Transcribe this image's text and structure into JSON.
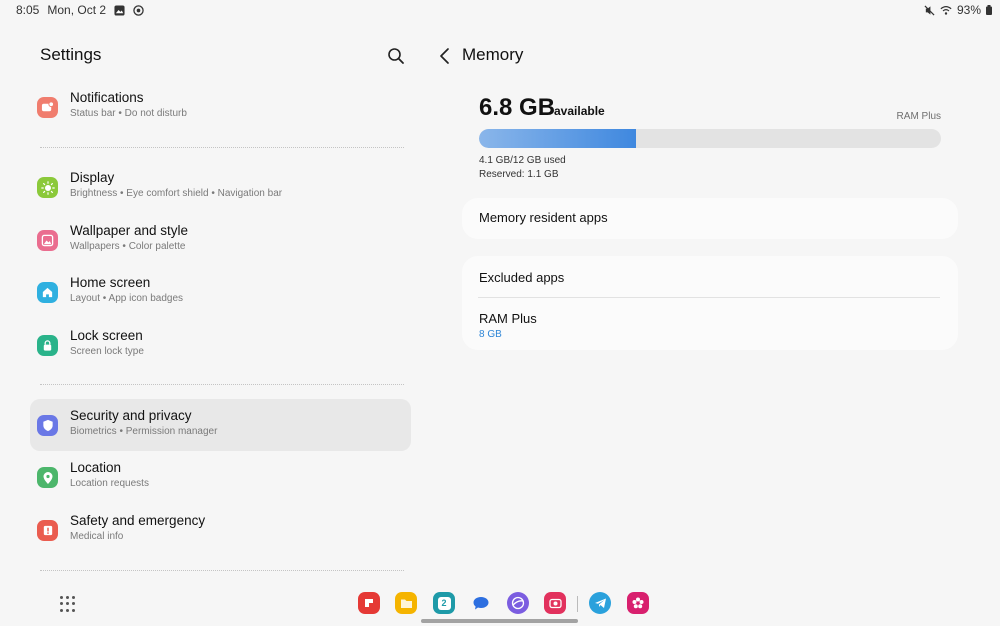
{
  "status_bar": {
    "time": "8:05",
    "date": "Mon, Oct 2",
    "battery": "93%"
  },
  "left": {
    "title": "Settings",
    "items": [
      {
        "title": "Notifications",
        "subtitle": "Status bar  •  Do not disturb",
        "icon": "notifications-icon",
        "color": "#f07d6e"
      },
      {
        "title": "Display",
        "subtitle": "Brightness  •  Eye comfort shield  •  Navigation bar",
        "icon": "display-icon",
        "color": "#8bc93a"
      },
      {
        "title": "Wallpaper and style",
        "subtitle": "Wallpapers  •  Color palette",
        "icon": "wallpaper-icon",
        "color": "#ea6d8f"
      },
      {
        "title": "Home screen",
        "subtitle": "Layout  •  App icon badges",
        "icon": "home-icon",
        "color": "#2fb0e0"
      },
      {
        "title": "Lock screen",
        "subtitle": "Screen lock type",
        "icon": "lock-icon",
        "color": "#2ab38a"
      },
      {
        "title": "Security and privacy",
        "subtitle": "Biometrics  •  Permission manager",
        "icon": "shield-icon",
        "color": "#6a78e6"
      },
      {
        "title": "Location",
        "subtitle": "Location requests",
        "icon": "location-icon",
        "color": "#4cb66b"
      },
      {
        "title": "Safety and emergency",
        "subtitle": "Medical info",
        "icon": "emergency-icon",
        "color": "#ea5c4f"
      }
    ]
  },
  "right": {
    "title": "Memory",
    "available_value": "6.8 GB",
    "available_label": "available",
    "ram_plus_label": "RAM Plus",
    "used_fraction": 0.34,
    "used_text": "4.1 GB/12 GB used",
    "reserved_text": "Reserved: 1.1 GB",
    "memory_resident_apps": "Memory resident apps",
    "excluded_apps": "Excluded apps",
    "ram_plus_title": "RAM Plus",
    "ram_plus_value": "8 GB"
  },
  "dock": {
    "apps": [
      "flipboard-app-icon",
      "files-app-icon",
      "calendar-app-icon",
      "messages-app-icon",
      "internet-app-icon",
      "camera-app-icon",
      "telegram-app-icon",
      "blossom-app-icon"
    ],
    "calendar_day": "2"
  }
}
